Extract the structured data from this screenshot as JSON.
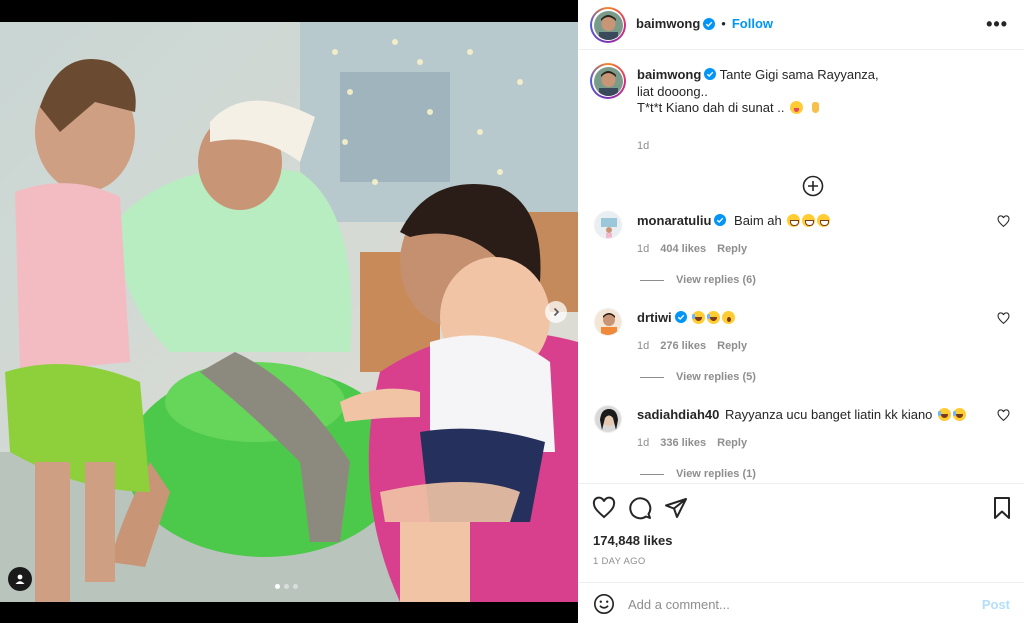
{
  "post": {
    "author": "baimwong",
    "header_separator": "•",
    "follow_label": "Follow",
    "more_label": "•••",
    "caption_lines": [
      "Tante Gigi sama Rayyanza,",
      "liat dooong..",
      "T*t*t Kiano dah di sunat .."
    ],
    "caption_time": "1d",
    "likes": "174,848 likes",
    "posted_ago": "1 DAY AGO",
    "carousel": {
      "slides": 3,
      "active": 0
    }
  },
  "comments": [
    {
      "user": "monaratuliu",
      "verified": true,
      "text": "Baim ah",
      "emojis": [
        "grin",
        "grin",
        "grin"
      ],
      "time": "1d",
      "likes": "404 likes",
      "reply_label": "Reply",
      "view_replies": "View replies (6)"
    },
    {
      "user": "drtiwi",
      "verified": true,
      "text": "",
      "emojis": [
        "laugh",
        "laugh",
        "wow"
      ],
      "time": "1d",
      "likes": "276 likes",
      "reply_label": "Reply",
      "view_replies": "View replies (5)"
    },
    {
      "user": "sadiahdiah40",
      "verified": false,
      "text": "Rayyanza ucu banget liatin kk kiano",
      "emojis": [
        "laugh",
        "laugh"
      ],
      "time": "1d",
      "likes": "336 likes",
      "reply_label": "Reply",
      "view_replies": "View replies (1)"
    }
  ],
  "add_comment": {
    "placeholder": "Add a comment...",
    "post_label": "Post"
  },
  "colors": {
    "accent": "#0095f6",
    "verified": "#0095f6",
    "post_disabled": "#b2dffc",
    "green_pouf": "#4cc94a"
  },
  "icons": [
    "heart-icon",
    "comment-icon",
    "share-icon",
    "bookmark-icon",
    "emoji-icon",
    "plus-circle-icon",
    "more-icon",
    "chevron-right-icon",
    "user-tag-icon"
  ]
}
